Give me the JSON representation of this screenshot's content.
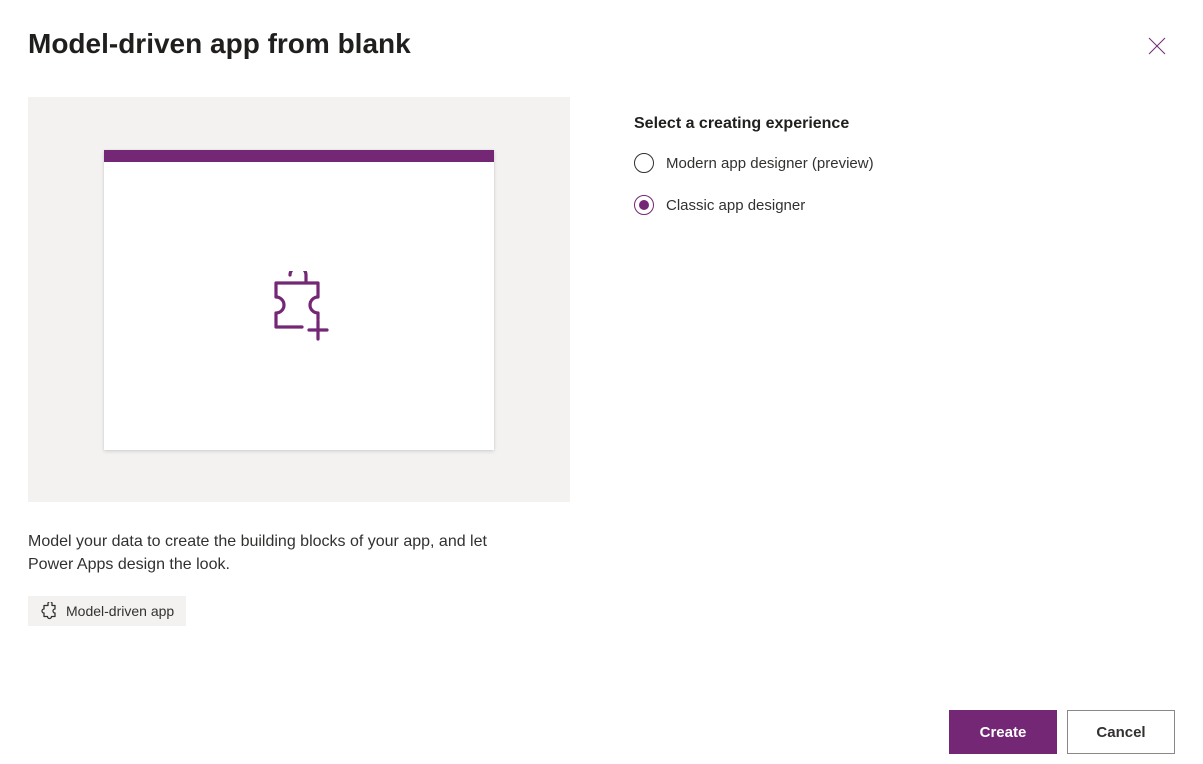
{
  "title": "Model-driven app from blank",
  "description": "Model your data to create the building blocks of your app, and let Power Apps design the look.",
  "tag_label": "Model-driven app",
  "section_label": "Select a creating experience",
  "options": {
    "modern": {
      "label": "Modern app designer (preview)",
      "selected": false
    },
    "classic": {
      "label": "Classic app designer",
      "selected": true
    }
  },
  "buttons": {
    "create": "Create",
    "cancel": "Cancel"
  }
}
